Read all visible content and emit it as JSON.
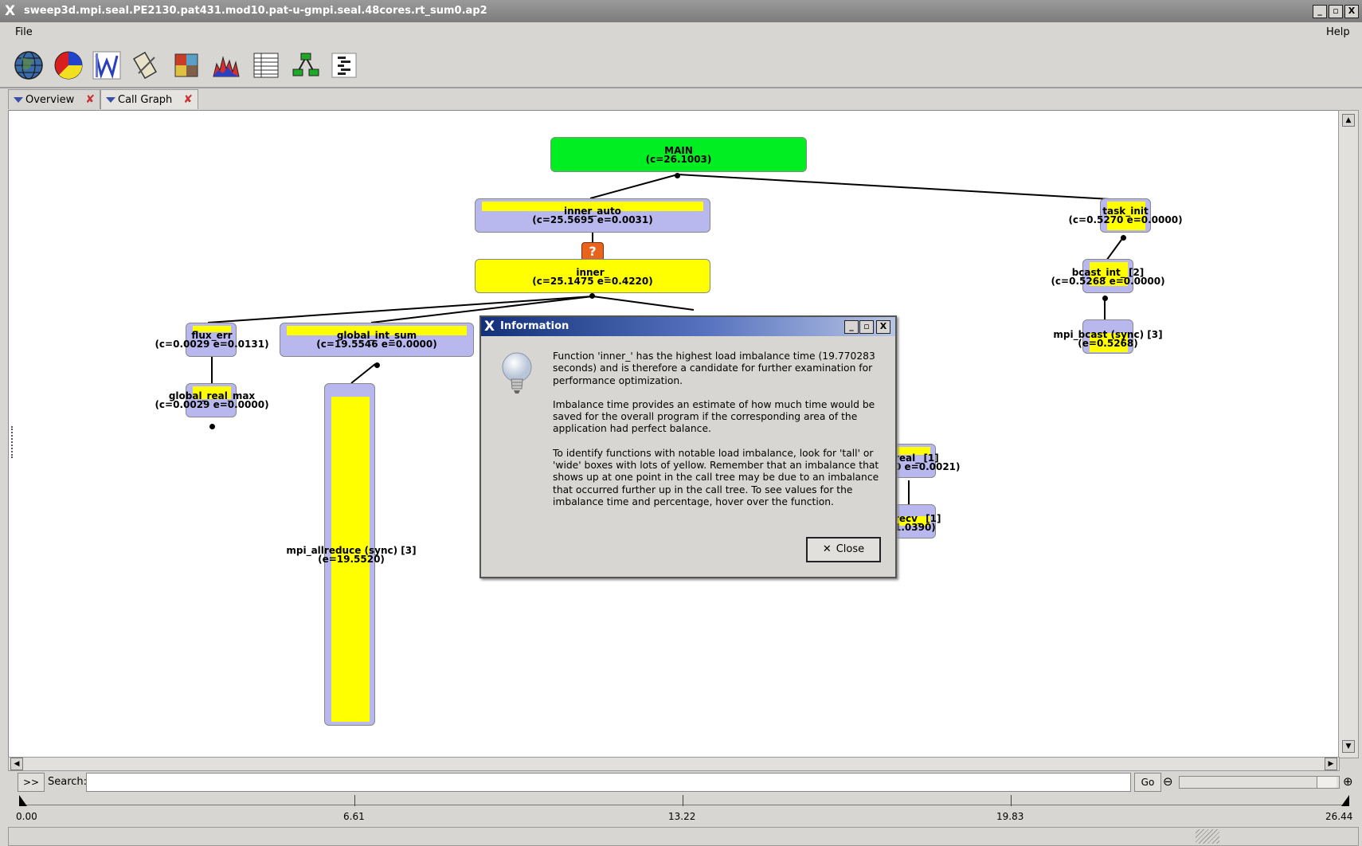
{
  "window": {
    "title": "sweep3d.mpi.seal.PE2130.pat431.mod10.pat-u-gmpi.seal.48cores.rt_sum0.ap2",
    "buttons": [
      "_",
      "▫",
      "X"
    ]
  },
  "menu": {
    "file": "File",
    "help": "Help"
  },
  "toolbar": {
    "icons": [
      "globe-icon",
      "pie-chart-icon",
      "load-balance-icon",
      "tools-icon",
      "mosaic-icon",
      "histogram-icon",
      "table-icon",
      "call-tree-icon",
      "text-report-icon"
    ]
  },
  "tabs": [
    {
      "label": "Overview"
    },
    {
      "label": "Call Graph"
    }
  ],
  "graph": {
    "nodes": {
      "main": {
        "name": "MAIN",
        "stats": "(c=26.1003)"
      },
      "inner_auto": {
        "name": "inner_auto",
        "stats": "(c=25.5695 e=0.0031)"
      },
      "inner": {
        "name": "inner_",
        "stats": "(c=25.1475 e=0.4220)"
      },
      "task_init": {
        "name": "task_init",
        "stats": "(c=0.5270 e=0.0000)"
      },
      "bcast_int": {
        "name": "bcast_int_ [2]",
        "stats": "(c=0.5268 e=0.0000)"
      },
      "mpi_bcast": {
        "name": "mpi_bcast (sync) [3]",
        "stats": "(e=0.5268)"
      },
      "flux_err": {
        "name": "flux_err",
        "stats": "(c=0.0029 e=0.0131)"
      },
      "global_int_sum": {
        "name": "global_int_sum",
        "stats": "(c=19.5546 e=0.0000)"
      },
      "global_real_max": {
        "name": "global_real_max",
        "stats": "(c=0.0029 e=0.0000)"
      },
      "mpi_allreduce": {
        "name": "mpi_allreduce (sync) [3]",
        "stats": "(e=19.5520)"
      },
      "partial_real": {
        "name": "real_ [1]",
        "stats": "0 e=0.0021)"
      },
      "partial_recv": {
        "name": "recv_ [1]",
        "stats": "1.0390)"
      }
    },
    "question_marker": "?"
  },
  "dialog": {
    "title": "Information",
    "paragraphs": [
      "Function 'inner_' has the highest load imbalance time (19.770283 seconds) and is therefore a candidate for further examination for performance optimization.",
      "Imbalance time provides an estimate of how much time would be saved for the overall program if the corresponding area of the application had perfect balance.",
      "To identify functions with notable load imbalance, look for 'tall' or 'wide' boxes with lots of yellow. Remember that an imbalance that shows up at one point in the call tree may be due to an imbalance that occurred further up in the call tree. To see values for the imbalance time and percentage, hover over the function."
    ],
    "close_label": "Close"
  },
  "search": {
    "expand_label": ">>",
    "label": "Search:",
    "value": "",
    "go_label": "Go"
  },
  "timeline": {
    "ticks": [
      "0.00",
      "6.61",
      "13.22",
      "19.83",
      "26.44"
    ]
  },
  "colors": {
    "main_green": "#00ee22",
    "imbalance_yellow": "#ffff00",
    "time_lavender": "#b8b8ee",
    "marker_orange": "#e8641c"
  }
}
